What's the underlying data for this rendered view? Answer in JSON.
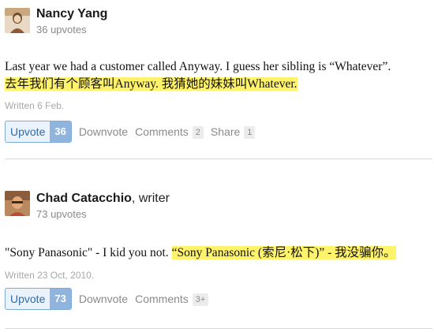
{
  "answers": [
    {
      "author_name": "Nancy Yang",
      "author_role": "",
      "upvotes_text": "36 upvotes",
      "body_plain": "Last year we had a customer called Anyway. I guess her sibling is “Whatever”.",
      "body_highlight": "去年我们有个顾客叫Anyway. 我猜她的妹妹叫Whatever.",
      "written": "Written 6 Feb.",
      "upvote_label": "Upvote",
      "upvote_count": "36",
      "downvote_label": "Downvote",
      "comments_label": "Comments",
      "comments_count": "2",
      "share_label": "Share",
      "share_count": "1"
    },
    {
      "author_name": "Chad Catacchio",
      "author_role": ", writer",
      "upvotes_text": "73 upvotes",
      "body_plain": "\"Sony Panasonic\" - I kid you not. ",
      "body_highlight": "“Sony Panasonic (索尼·松下)” - 我没骗你。",
      "written": "Written 23 Oct, 2010.",
      "upvote_label": "Upvote",
      "upvote_count": "73",
      "downvote_label": "Downvote",
      "comments_label": "Comments",
      "comments_count": "3+"
    }
  ]
}
